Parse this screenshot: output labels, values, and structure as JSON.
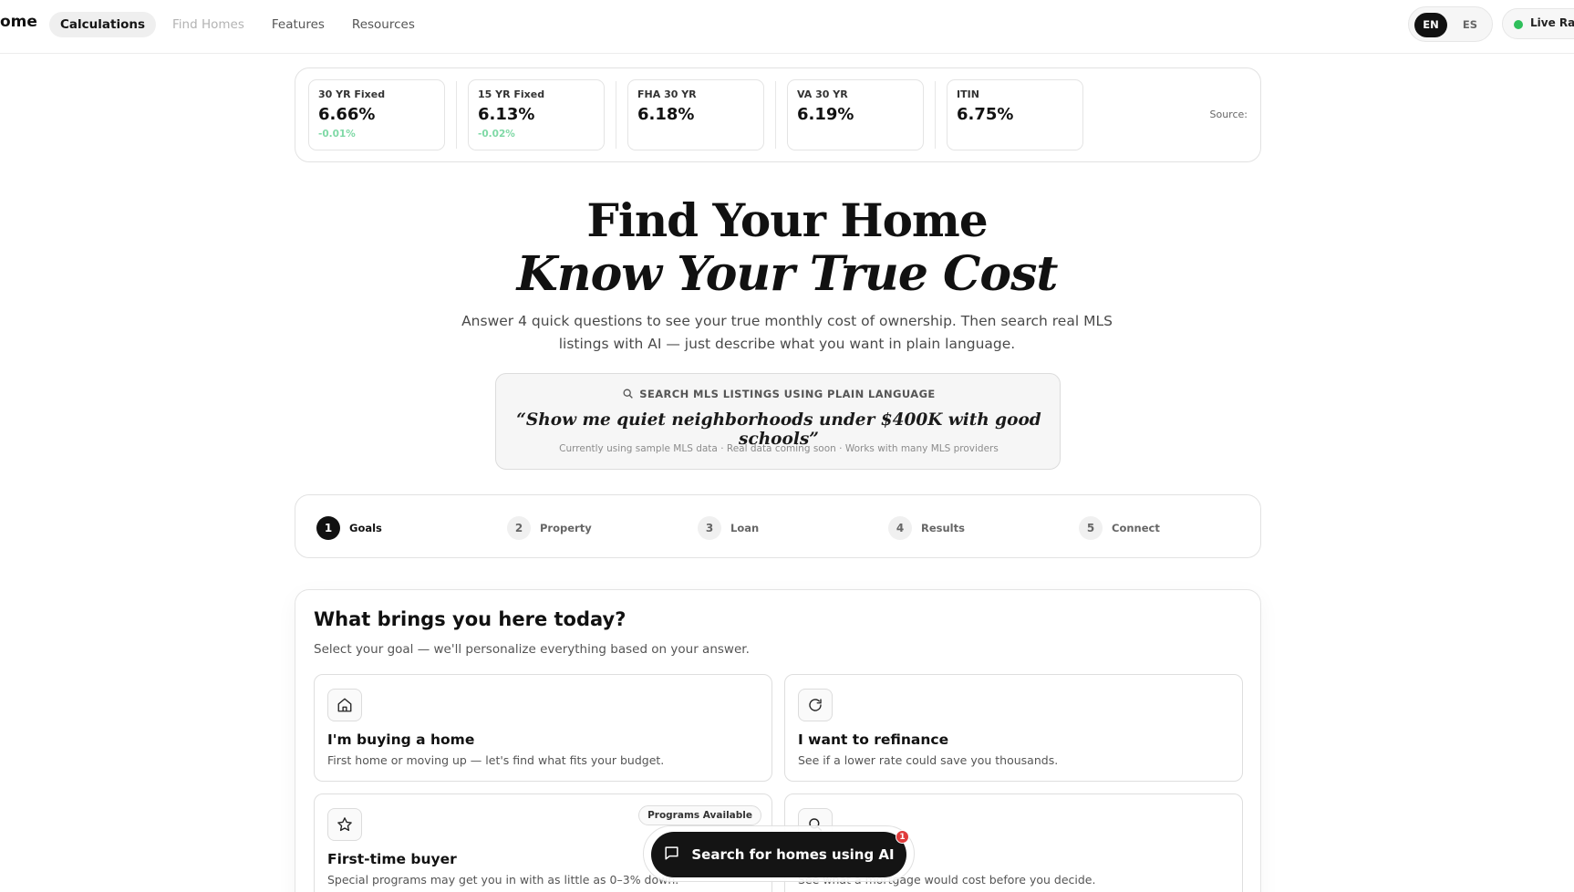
{
  "nav": {
    "brand": "ome",
    "items": [
      {
        "label": "Calculations"
      },
      {
        "label": "Find Homes"
      },
      {
        "label": "Features"
      },
      {
        "label": "Resources"
      }
    ],
    "lang": {
      "en": "EN",
      "es": "ES",
      "selected": "EN"
    },
    "live_rates": "Live Rat"
  },
  "rates": {
    "cards": [
      {
        "name": "30 YR Fixed",
        "value": "6.66%",
        "change": "-0.01%"
      },
      {
        "name": "15 YR Fixed",
        "value": "6.13%",
        "change": "-0.02%"
      },
      {
        "name": "FHA 30 YR",
        "value": "6.18%",
        "change": ""
      },
      {
        "name": "VA 30 YR",
        "value": "6.19%",
        "change": ""
      },
      {
        "name": "ITIN",
        "value": "6.75%",
        "change": ""
      }
    ],
    "source_label": "Source:",
    "change_color": "#7fd9a6"
  },
  "hero": {
    "title_line1": "Find Your Home",
    "title_line2": "Know Your True Cost",
    "subtitle": "Answer 4 quick questions to see your true monthly cost of ownership. Then search real MLS listings with AI — just describe what you want in plain language."
  },
  "search_card": {
    "kicker": "SEARCH MLS LISTINGS USING PLAIN LANGUAGE",
    "quote": "“Show me quiet neighborhoods under $400K with good schools”",
    "note": "Currently using sample MLS data · Real data coming soon · Works with many MLS providers"
  },
  "stepper": {
    "steps": [
      {
        "num": "1",
        "label": "Goals",
        "active": true
      },
      {
        "num": "2",
        "label": "Property"
      },
      {
        "num": "3",
        "label": "Loan"
      },
      {
        "num": "4",
        "label": "Results"
      },
      {
        "num": "5",
        "label": "Connect"
      }
    ]
  },
  "goal": {
    "title": "What brings you here today?",
    "subtitle": "Select your goal — we'll personalize everything based on your answer.",
    "options": [
      {
        "icon": "home-icon",
        "title": "I'm buying a home",
        "desc": "First home or moving up — let's find what fits your budget."
      },
      {
        "icon": "refresh-icon",
        "title": "I want to refinance",
        "desc": "See if a lower rate could save you thousands."
      },
      {
        "icon": "star-icon",
        "title": "First-time buyer",
        "desc": "Special programs may get you in with as little as 0–3% down.",
        "badge": "Programs Available"
      },
      {
        "icon": "search-icon",
        "title": "",
        "desc": "See what a mortgage would cost before you decide."
      }
    ]
  },
  "ai_button": {
    "label": "Search for homes using AI",
    "badge": "1",
    "icon": "chat-icon"
  }
}
